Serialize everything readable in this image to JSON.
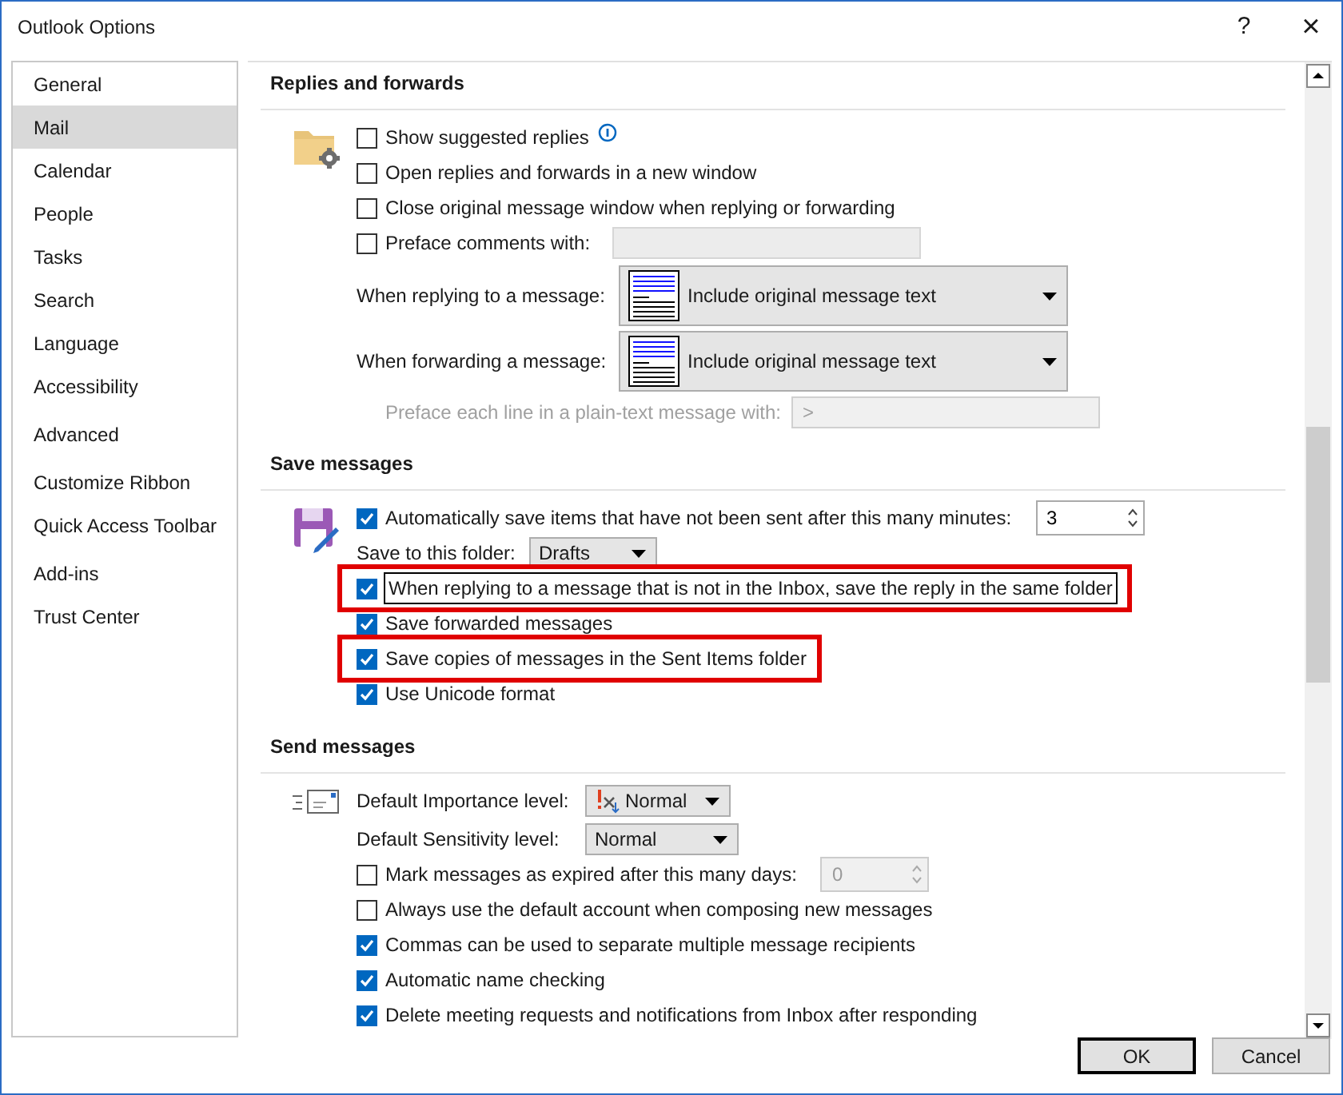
{
  "window": {
    "title": "Outlook Options",
    "help": "?",
    "close": "×"
  },
  "sidebar": {
    "groups": [
      [
        {
          "label": "General",
          "selected": false
        },
        {
          "label": "Mail",
          "selected": true
        },
        {
          "label": "Calendar",
          "selected": false
        },
        {
          "label": "People",
          "selected": false
        },
        {
          "label": "Tasks",
          "selected": false
        },
        {
          "label": "Search",
          "selected": false
        },
        {
          "label": "Language",
          "selected": false
        },
        {
          "label": "Accessibility",
          "selected": false
        }
      ],
      [
        {
          "label": "Advanced",
          "selected": false
        }
      ],
      [
        {
          "label": "Customize Ribbon",
          "selected": false
        },
        {
          "label": "Quick Access Toolbar",
          "selected": false
        }
      ],
      [
        {
          "label": "Add-ins",
          "selected": false
        },
        {
          "label": "Trust Center",
          "selected": false
        }
      ]
    ]
  },
  "sections": [
    {
      "title": "Replies and forwards",
      "rows": [
        {
          "kind": "checkbox",
          "label": "Show suggested replies",
          "checked": false,
          "info": true
        },
        {
          "kind": "checkbox",
          "label": "Open replies and forwards in a new window",
          "checked": false
        },
        {
          "kind": "checkbox",
          "label": "Close original message window when replying or forwarding",
          "checked": false
        },
        {
          "kind": "checkbox-field",
          "label": "Preface comments with:",
          "checked": false
        },
        {
          "kind": "dropdown",
          "label": "When replying to a message:",
          "value": "Include original message text"
        },
        {
          "kind": "dropdown",
          "label": "When forwarding a message:",
          "value": "Include original message text"
        },
        {
          "kind": "field",
          "label": "Preface each line in a plain-text message with:",
          "value": ">",
          "disabled": true
        }
      ]
    },
    {
      "title": "Save messages",
      "rows": [
        {
          "kind": "checkbox-spin",
          "label": "Automatically save items that have not been sent after this many minutes:",
          "checked": true,
          "value": "3",
          "disabled": false
        },
        {
          "kind": "select",
          "label": "Save to this folder:",
          "value": "Drafts"
        },
        {
          "kind": "checkbox",
          "label": "When replying to a message that is not in the Inbox, save the reply in the same folder",
          "checked": true,
          "highlighted": true,
          "focused": true
        },
        {
          "kind": "checkbox",
          "label": "Save forwarded messages",
          "checked": true
        },
        {
          "kind": "checkbox",
          "label": "Save copies of messages in the Sent Items folder",
          "checked": true,
          "highlighted": true
        },
        {
          "kind": "checkbox",
          "label": "Use Unicode format",
          "checked": true
        }
      ]
    },
    {
      "title": "Send messages",
      "rows": [
        {
          "kind": "select",
          "label": "Default Importance level:",
          "value": "Normal",
          "importance_icon": true
        },
        {
          "kind": "select",
          "label": "Default Sensitivity level:",
          "value": "Normal"
        },
        {
          "kind": "checkbox-spin",
          "label": "Mark messages as expired after this many days:",
          "checked": false,
          "value": "0",
          "disabled": true
        },
        {
          "kind": "checkbox",
          "label": "Always use the default account when composing new messages",
          "checked": false
        },
        {
          "kind": "checkbox",
          "label": "Commas can be used to separate multiple message recipients",
          "checked": true
        },
        {
          "kind": "checkbox",
          "label": "Automatic name checking",
          "checked": true
        },
        {
          "kind": "checkbox",
          "label": "Delete meeting requests and notifications from Inbox after responding",
          "checked": true
        }
      ]
    }
  ],
  "buttons": [
    {
      "label": "OK",
      "default": true
    },
    {
      "label": "Cancel",
      "default": false
    }
  ]
}
